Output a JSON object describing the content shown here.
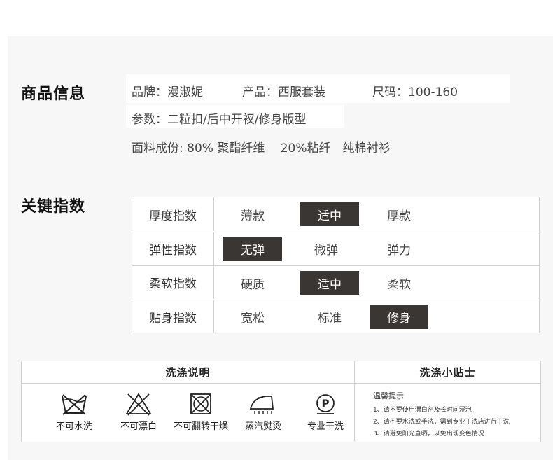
{
  "product_info": {
    "title": "商品信息",
    "brand": "品牌：漫淑妮",
    "product": "产品：西服套装",
    "size": "尺码：100-160",
    "params": "参数：二粒扣/后中开衩/修身版型",
    "fabric": "面料成份: 80% 聚酯纤维　 20%粘纤　纯棉衬衫"
  },
  "key_index": {
    "title": "关键指数",
    "rows": [
      {
        "label": "厚度指数",
        "options": [
          "薄款",
          "适中",
          "厚款"
        ],
        "selected": 1
      },
      {
        "label": "弹性指数",
        "options": [
          "无弹",
          "微弹",
          "弹力"
        ],
        "selected": 0
      },
      {
        "label": "柔软指数",
        "options": [
          "硬质",
          "适中",
          "柔软"
        ],
        "selected": 1
      },
      {
        "label": "贴身指数",
        "options": [
          "宽松",
          "标准",
          "修身"
        ],
        "selected": 2
      }
    ]
  },
  "washing": {
    "title": "洗涤说明",
    "symbols": [
      {
        "icon": "no-wash-icon",
        "label": "不可水洗"
      },
      {
        "icon": "no-bleach-icon",
        "label": "不可漂白"
      },
      {
        "icon": "no-tumble-dry-icon",
        "label": "不可翻转干燥"
      },
      {
        "icon": "steam-iron-icon",
        "label": "蒸汽熨烫"
      },
      {
        "icon": "professional-dry-clean-icon",
        "label": "专业干洗"
      }
    ]
  },
  "tips": {
    "title": "洗涤小贴士",
    "subtitle": "温馨提示",
    "items": [
      "1、请不要使用漂白剂及长时间浸泡",
      "2、请不要水洗或手洗，需到专业干洗店进行干洗",
      "3、请避免阳光直晒，以免出现变色情况"
    ]
  }
}
